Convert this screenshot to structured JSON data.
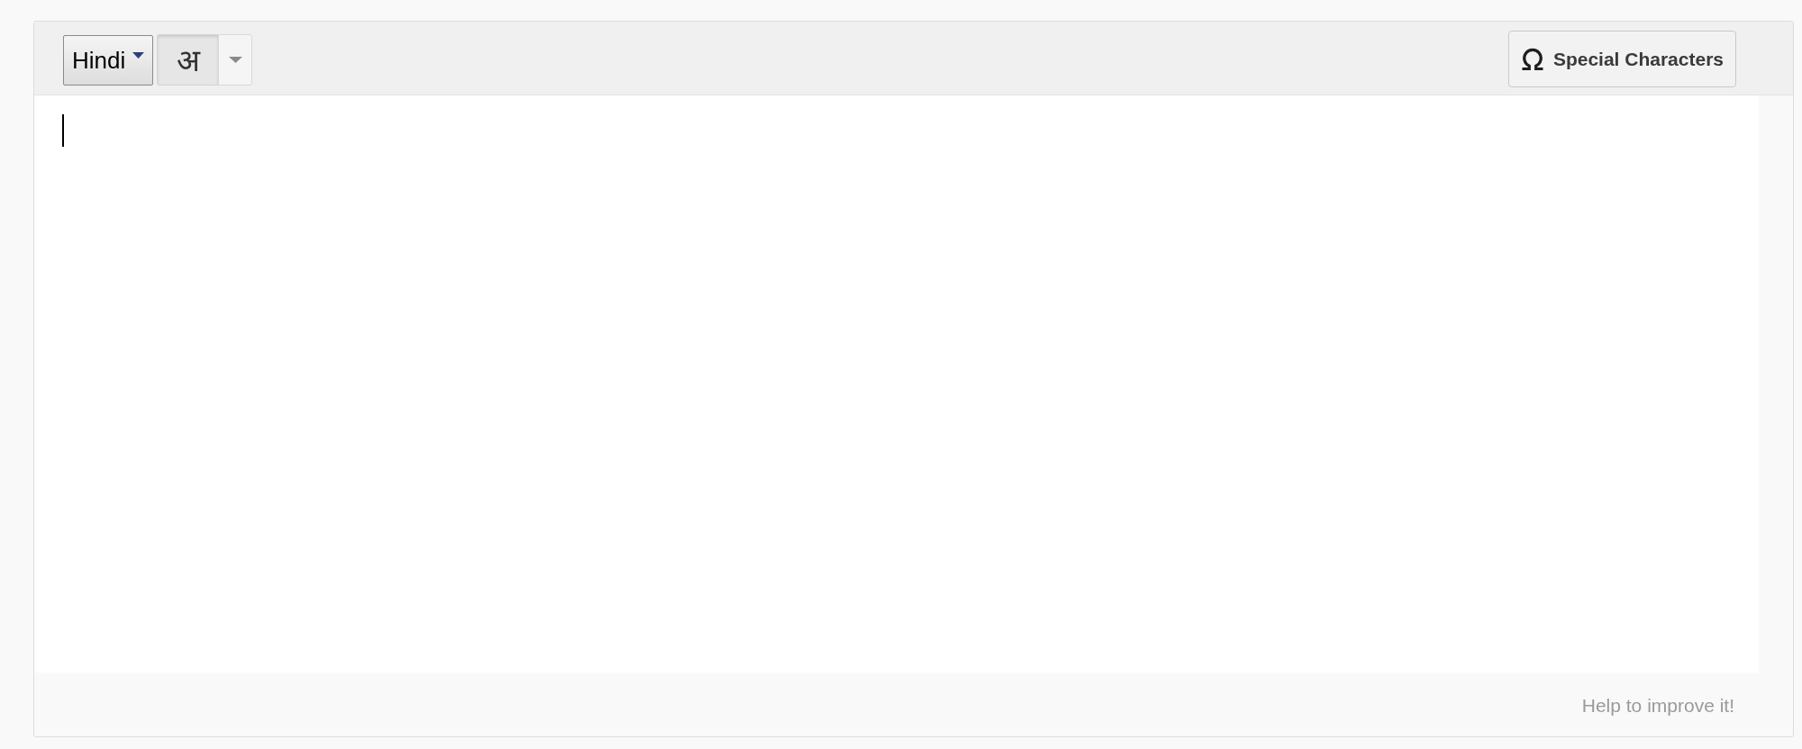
{
  "toolbar": {
    "language_menu": {
      "label": "Hindi"
    },
    "input_tool": {
      "label": "अ",
      "on": true
    },
    "special_characters": {
      "label": "Special Characters"
    }
  },
  "editor": {
    "focused": true
  },
  "footer": {
    "help_link": "Help to improve it!"
  }
}
